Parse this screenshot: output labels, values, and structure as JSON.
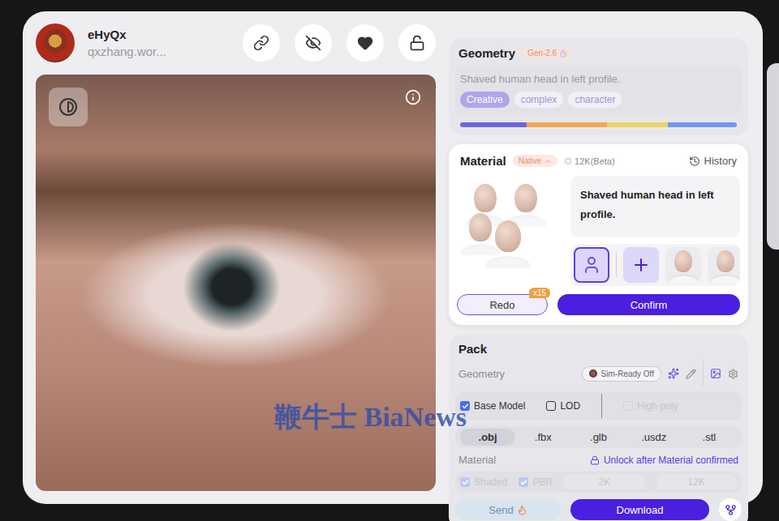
{
  "user": {
    "name": "eHyQx",
    "handle": "qxzhang.wor..."
  },
  "watermark": "鞭牛士 BiaNews",
  "geometry": {
    "title": "Geometry",
    "badge": "Gen-2.6",
    "prompt": "Shaved human head in left profile.",
    "tags": [
      {
        "label": "Creative",
        "selected": true
      },
      {
        "label": "complex",
        "selected": false
      },
      {
        "label": "character",
        "selected": false
      }
    ],
    "bar": [
      {
        "color": "#5b4fe0",
        "level": 0.24
      },
      {
        "color": "#f0a040",
        "level": 0.29
      },
      {
        "color": "#f2d050",
        "level": 0.22
      },
      {
        "color": "#5b8ef0",
        "level": 0.25
      }
    ]
  },
  "material": {
    "title": "Material",
    "mode": "Native",
    "resolution": "12K(Beta)",
    "history": "History",
    "prompt": "Shaved human head in left profile.",
    "thumbnails": [
      {
        "kind": "mesh",
        "selected": true
      },
      {
        "kind": "add",
        "selected": false
      },
      {
        "kind": "head",
        "selected": false
      },
      {
        "kind": "head",
        "selected": false
      }
    ],
    "redo": "Redo",
    "redo_count": "x15",
    "confirm": "Confirm"
  },
  "pack": {
    "title": "Pack",
    "geometry_label": "Geometry",
    "sim_ready": "Sim-Ready Off",
    "sim_ready_on": false,
    "options": [
      {
        "label": "Base Model",
        "checked": true,
        "disabled": false
      },
      {
        "label": "LOD",
        "checked": false,
        "disabled": false
      },
      {
        "label": "High-poly",
        "checked": false,
        "disabled": true
      }
    ],
    "formats": [
      {
        "label": ".obj",
        "selected": true
      },
      {
        "label": ".fbx",
        "selected": false
      },
      {
        "label": ".glb",
        "selected": false
      },
      {
        "label": ".usdz",
        "selected": false
      },
      {
        "label": ".stl",
        "selected": false
      }
    ],
    "material_label": "Material",
    "lock_note": "Unlock after Material confirmed",
    "material_options": [
      {
        "label": "Shaded",
        "kind": "checkbox",
        "checked": true,
        "disabled": true
      },
      {
        "label": "PBR",
        "kind": "checkbox",
        "checked": true,
        "disabled": true
      },
      {
        "label": "2K",
        "kind": "size",
        "checked": false,
        "disabled": true
      },
      {
        "label": "12K",
        "kind": "size",
        "checked": false,
        "disabled": true
      }
    ],
    "send": "Send",
    "download": "Download"
  }
}
